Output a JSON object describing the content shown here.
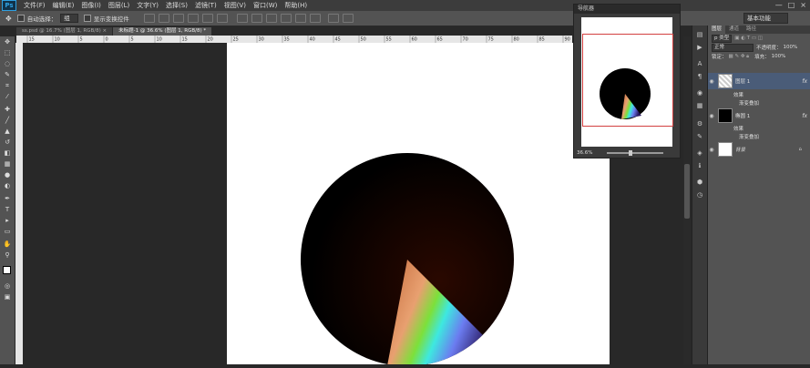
{
  "app": {
    "logo": "Ps"
  },
  "menu": [
    "文件(F)",
    "编辑(E)",
    "图像(I)",
    "图层(L)",
    "文字(Y)",
    "选择(S)",
    "滤镜(T)",
    "视图(V)",
    "窗口(W)",
    "帮助(H)"
  ],
  "window_controls": [
    "—",
    "□",
    "×"
  ],
  "options": {
    "auto_select": "自动选择：",
    "auto_select_value": "组",
    "show_transform": "显示变换控件",
    "preset": "基本功能"
  },
  "tabs": [
    {
      "label": "ss.psd @ 16.7% (图层 1, RGB/8) ×",
      "active": false
    },
    {
      "label": "未标题-1 @ 36.6% (图层 1, RGB/8) *",
      "active": true
    }
  ],
  "ruler_ticks": [
    "15",
    "10",
    "5",
    "0",
    "5",
    "10",
    "15",
    "20",
    "25",
    "30",
    "35",
    "40",
    "45",
    "50",
    "55",
    "60",
    "65",
    "70",
    "75",
    "80",
    "85",
    "90"
  ],
  "navigator": {
    "title": "导航器",
    "zoom": "36.6%"
  },
  "layers_panel": {
    "tabs": [
      "图层",
      "通道",
      "路径"
    ],
    "kind": "p 类型",
    "blend_mode": "正常",
    "opacity_label": "不透明度：",
    "opacity": "100%",
    "lock_label": "锁定：",
    "fill_label": "填充：",
    "fill": "100%",
    "layers": [
      {
        "name": "图层 1",
        "fx": "fx",
        "selected": true,
        "effects_label": "效果",
        "effect": "渐变叠加"
      },
      {
        "name": "椭圆 1",
        "fx": "fx",
        "selected": false,
        "effects_label": "效果",
        "effect": "渐变叠加"
      },
      {
        "name": "背景",
        "fx": "",
        "selected": false
      }
    ]
  },
  "colors": {
    "accent": "#2fa0e0",
    "background": "#282828",
    "panel": "#535353"
  }
}
